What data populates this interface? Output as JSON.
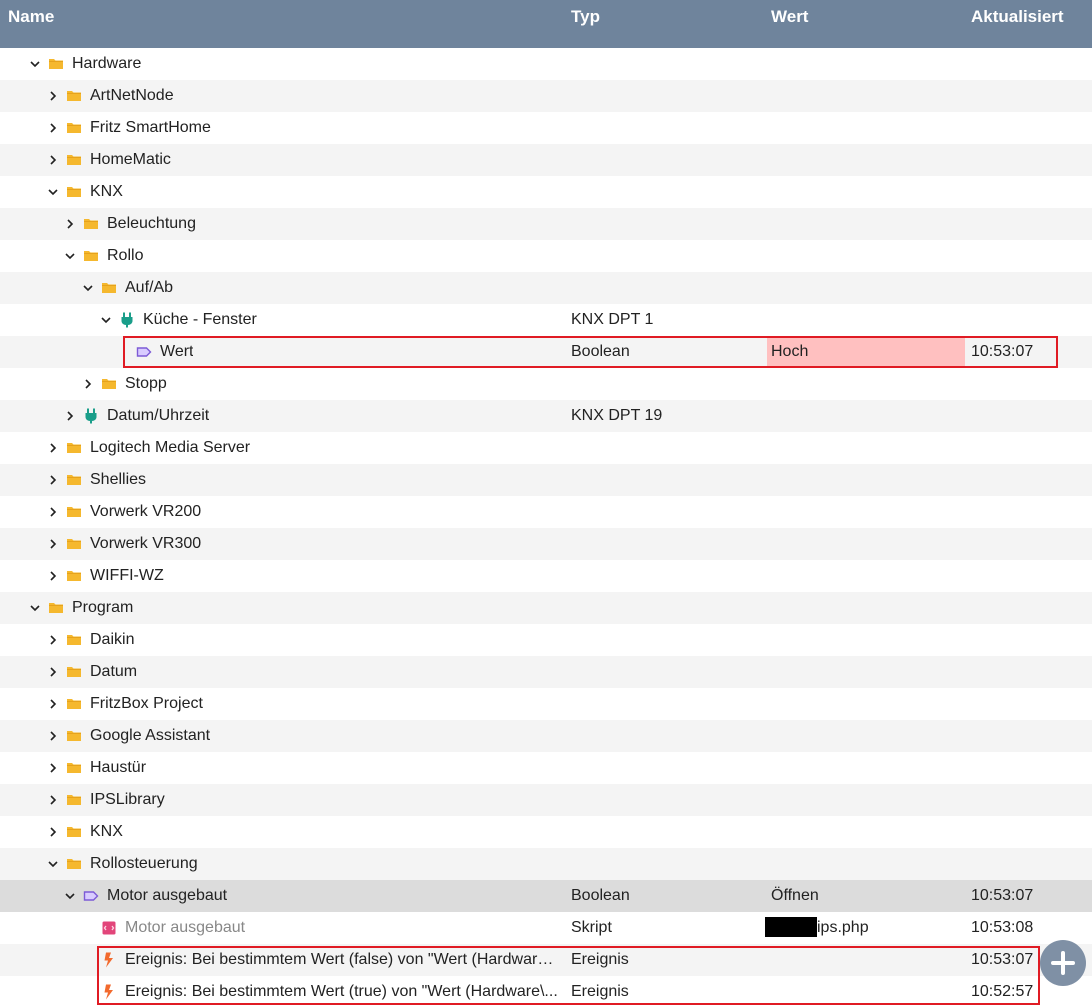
{
  "header": {
    "name": "Name",
    "typ": "Typ",
    "wert": "Wert",
    "aktualisiert": "Aktualisiert"
  },
  "rows": [
    {
      "name": "Hardware",
      "icon": "folder-icon",
      "expanded": true,
      "typ": "",
      "wert": "",
      "akt": ""
    },
    {
      "name": "ArtNetNode",
      "icon": "folder-icon",
      "expanded": false,
      "typ": "",
      "wert": "",
      "akt": ""
    },
    {
      "name": "Fritz SmartHome",
      "icon": "folder-icon",
      "expanded": false,
      "typ": "",
      "wert": "",
      "akt": ""
    },
    {
      "name": "HomeMatic",
      "icon": "folder-icon",
      "expanded": false,
      "typ": "",
      "wert": "",
      "akt": ""
    },
    {
      "name": "KNX",
      "icon": "folder-icon",
      "expanded": true,
      "typ": "",
      "wert": "",
      "akt": ""
    },
    {
      "name": "Beleuchtung",
      "icon": "folder-icon",
      "expanded": false,
      "typ": "",
      "wert": "",
      "akt": ""
    },
    {
      "name": "Rollo",
      "icon": "folder-icon",
      "expanded": true,
      "typ": "",
      "wert": "",
      "akt": ""
    },
    {
      "name": "Auf/Ab",
      "icon": "folder-icon",
      "expanded": true,
      "typ": "",
      "wert": "",
      "akt": ""
    },
    {
      "name": "Küche - Fenster",
      "icon": "plug-icon",
      "expanded": true,
      "typ": "KNX DPT 1",
      "wert": "",
      "akt": ""
    },
    {
      "name": "Wert",
      "icon": "variable-tag-icon",
      "typ": "Boolean",
      "wert": "Hoch",
      "akt": "10:53:07"
    },
    {
      "name": "Stopp",
      "icon": "folder-icon",
      "expanded": false,
      "typ": "",
      "wert": "",
      "akt": ""
    },
    {
      "name": "Datum/Uhrzeit",
      "icon": "plug-icon",
      "expanded": false,
      "typ": "KNX DPT 19",
      "wert": "",
      "akt": ""
    },
    {
      "name": "Logitech Media Server",
      "icon": "folder-icon",
      "expanded": false,
      "typ": "",
      "wert": "",
      "akt": ""
    },
    {
      "name": "Shellies",
      "icon": "folder-icon",
      "expanded": false,
      "typ": "",
      "wert": "",
      "akt": ""
    },
    {
      "name": "Vorwerk VR200",
      "icon": "folder-icon",
      "expanded": false,
      "typ": "",
      "wert": "",
      "akt": ""
    },
    {
      "name": "Vorwerk VR300",
      "icon": "folder-icon",
      "expanded": false,
      "typ": "",
      "wert": "",
      "akt": ""
    },
    {
      "name": "WIFFI-WZ",
      "icon": "folder-icon",
      "expanded": false,
      "typ": "",
      "wert": "",
      "akt": ""
    },
    {
      "name": "Program",
      "icon": "folder-icon",
      "expanded": true,
      "typ": "",
      "wert": "",
      "akt": ""
    },
    {
      "name": "Daikin",
      "icon": "folder-icon",
      "expanded": false,
      "typ": "",
      "wert": "",
      "akt": ""
    },
    {
      "name": "Datum",
      "icon": "folder-icon",
      "expanded": false,
      "typ": "",
      "wert": "",
      "akt": ""
    },
    {
      "name": "FritzBox Project",
      "icon": "folder-icon",
      "expanded": false,
      "typ": "",
      "wert": "",
      "akt": ""
    },
    {
      "name": "Google Assistant",
      "icon": "folder-icon",
      "expanded": false,
      "typ": "",
      "wert": "",
      "akt": ""
    },
    {
      "name": "Haustür",
      "icon": "folder-icon",
      "expanded": false,
      "typ": "",
      "wert": "",
      "akt": ""
    },
    {
      "name": "IPSLibrary",
      "icon": "folder-icon",
      "expanded": false,
      "typ": "",
      "wert": "",
      "akt": ""
    },
    {
      "name": "KNX",
      "icon": "folder-icon",
      "expanded": false,
      "typ": "",
      "wert": "",
      "akt": ""
    },
    {
      "name": "Rollosteuerung",
      "icon": "folder-icon",
      "expanded": true,
      "typ": "",
      "wert": "",
      "akt": ""
    },
    {
      "name": "Motor ausgebaut",
      "icon": "variable-tag-icon",
      "expanded": true,
      "typ": "Boolean",
      "wert": "Öffnen",
      "akt": "10:53:07"
    },
    {
      "name": "Motor ausgebaut",
      "icon": "script-icon",
      "typ": "Skript",
      "wert": "ips.php",
      "akt": "10:53:08"
    },
    {
      "name": "Ereignis: Bei bestimmtem Wert (false) von \"Wert (Hardware\\...",
      "icon": "event-bolt-icon",
      "typ": "Ereignis",
      "wert": "",
      "akt": "10:53:07"
    },
    {
      "name": "Ereignis: Bei bestimmtem Wert (true) von \"Wert (Hardware\\...",
      "icon": "event-bolt-icon",
      "typ": "Ereignis",
      "wert": "",
      "akt": "10:52:57"
    }
  ],
  "colors": {
    "header_bg": "#6f849c",
    "row_alt": "#f4f4f4",
    "selected_row": "#dcdcdc",
    "value_highlight": "#ffc0c0",
    "outline": "#e01b24",
    "folder": "#f5b82e",
    "plug": "#1a9e8a",
    "variable_tag": "#7d5bd6",
    "script": "#e2457a",
    "event_bolt": "#f26a2e",
    "fab": "#7f90a5"
  }
}
